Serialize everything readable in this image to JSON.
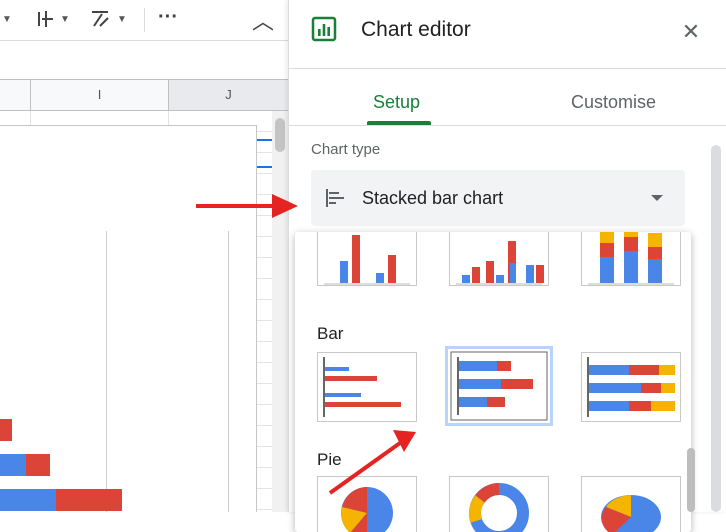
{
  "spreadsheet": {
    "columns": [
      "I",
      "J"
    ],
    "toolbar_icons": [
      "align-vertical-icon",
      "text-rotation-icon",
      "more-icon",
      "collapse-icon"
    ],
    "more_glyph": "···",
    "collapse_glyph": "︿"
  },
  "editor": {
    "title": "Chart editor",
    "close_glyph": "✕",
    "tabs": [
      {
        "label": "Setup",
        "active": true
      },
      {
        "label": "Customise",
        "active": false
      }
    ],
    "chart_type_label": "Chart type",
    "chart_type_value": "Stacked bar chart",
    "sections": [
      {
        "label": "Bar"
      },
      {
        "label": "Pie"
      }
    ]
  },
  "colors": {
    "accent_green": "#188038",
    "blue": "#4a86e8",
    "red": "#db4437",
    "yellow": "#f4b400",
    "arrow_red": "#e52320",
    "selected_border": "#bad3fb"
  }
}
